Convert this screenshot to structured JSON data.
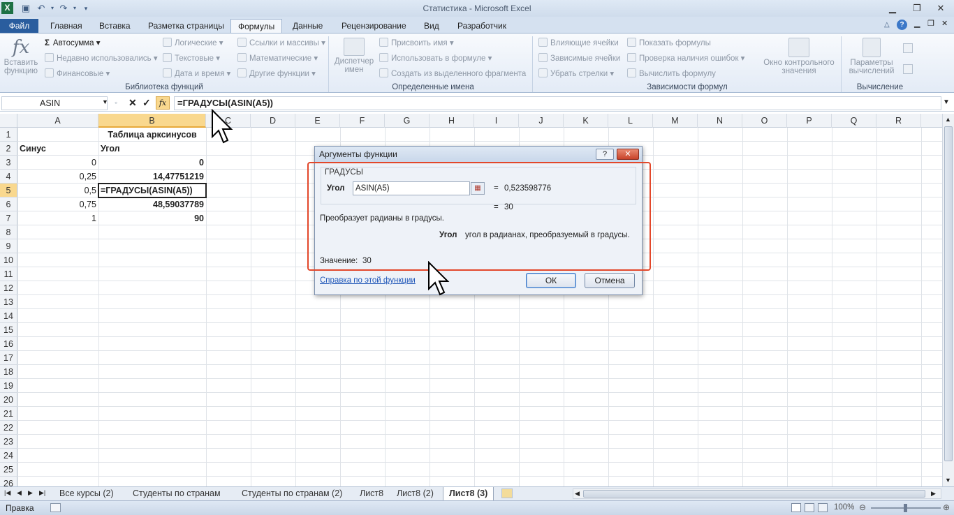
{
  "window": {
    "title": "Статистика - Microsoft Excel",
    "app_icon": "X"
  },
  "tabs": [
    "Файл",
    "Главная",
    "Вставка",
    "Разметка страницы",
    "Формулы",
    "Данные",
    "Рецензирование",
    "Вид",
    "Разработчик"
  ],
  "ribbon": {
    "insert_function": {
      "icon": "fx",
      "line1": "Вставить",
      "line2": "функцию"
    },
    "library": {
      "autosum": "Автосумма",
      "recent": "Недавно использовались",
      "financial": "Финансовые",
      "logical": "Логические",
      "text": "Текстовые",
      "datetime": "Дата и время",
      "lookup": "Ссылки и массивы",
      "math": "Математические",
      "other": "Другие функции",
      "group_label": "Библиотека функций"
    },
    "names": {
      "manager_line1": "Диспетчер",
      "manager_line2": "имен",
      "assign": "Присвоить имя",
      "use_in_formula": "Использовать в формуле",
      "create_from_selection": "Создать из выделенного фрагмента",
      "group_label": "Определенные имена"
    },
    "audit": {
      "precedents": "Влияющие ячейки",
      "dependents": "Зависимые ячейки",
      "remove_arrows": "Убрать стрелки",
      "show_formulas": "Показать формулы",
      "error_check": "Проверка наличия ошибок",
      "evaluate": "Вычислить формулу",
      "watch_line1": "Окно контрольного",
      "watch_line2": "значения",
      "group_label": "Зависимости формул"
    },
    "calc": {
      "options_line1": "Параметры",
      "options_line2": "вычислений",
      "group_label": "Вычисление"
    }
  },
  "formula_bar": {
    "name_box": "ASIN",
    "fx_label": "fx",
    "cancel": "✕",
    "enter": "✓",
    "formula": "=ГРАДУСЫ(ASIN(A5))"
  },
  "columns": [
    "A",
    "B",
    "C",
    "D",
    "E",
    "F",
    "G",
    "H",
    "I",
    "J",
    "K",
    "L",
    "M",
    "N",
    "O",
    "P",
    "Q",
    "R"
  ],
  "rows": [
    "1",
    "2",
    "3",
    "4",
    "5",
    "6",
    "7",
    "8",
    "9",
    "10",
    "11",
    "12",
    "13",
    "14",
    "15",
    "16",
    "17",
    "18",
    "19",
    "20",
    "21",
    "22",
    "23",
    "24",
    "25",
    "26"
  ],
  "sheet": {
    "title": "Таблица арксинусов",
    "header_a": "Синус",
    "header_b": "Угол",
    "data": [
      {
        "a": "0",
        "b": "0"
      },
      {
        "a": "0,25",
        "b": "14,47751219"
      },
      {
        "a": "0,5",
        "b": "=ГРАДУСЫ(ASIN(A5))"
      },
      {
        "a": "0,75",
        "b": "48,59037789"
      },
      {
        "a": "1",
        "b": "90"
      }
    ]
  },
  "dialog": {
    "title": "Аргументы функции",
    "help_btn": "?",
    "close_btn": "✕",
    "function_name": "ГРАДУСЫ",
    "arg_label": "Угол",
    "arg_value": "ASIN(A5)",
    "arg_result": "0,523598776",
    "eq": "=",
    "func_result": "30",
    "description": "Преобразует радианы в градусы.",
    "arg_desc_name": "Угол",
    "arg_desc_text": "угол в радианах, преобразуемый в градусы.",
    "value_label": "Значение:",
    "value": "30",
    "help_link": "Справка по этой функции",
    "ok": "ОК",
    "cancel": "Отмена"
  },
  "sheet_tabs": [
    "Все курсы (2)",
    "Студенты по странам",
    "Студенты по странам (2)",
    "Лист8",
    "Лист8 (2)",
    "Лист8 (3)"
  ],
  "status": {
    "mode": "Правка",
    "zoom": "100%"
  },
  "colors": {
    "accent": "#2a5d9e",
    "highlight": "#f9d88e",
    "red_outline": "#e2472a"
  }
}
